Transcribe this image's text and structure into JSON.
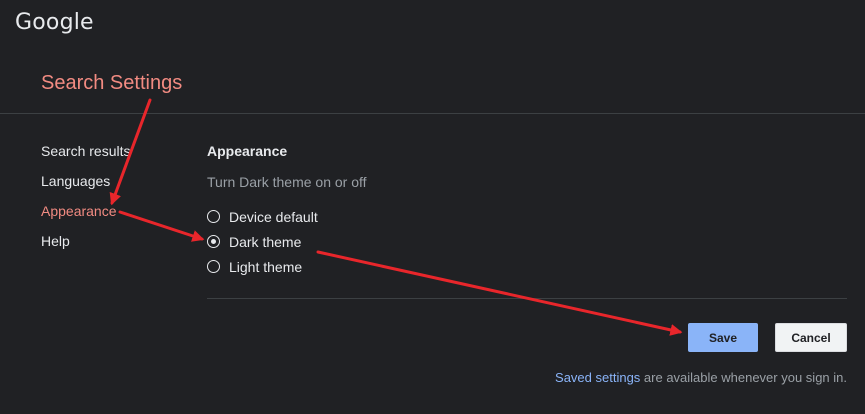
{
  "header": {
    "logo_text": "Google",
    "page_title": "Search Settings"
  },
  "sidebar": {
    "items": [
      {
        "label": "Search results",
        "active": false
      },
      {
        "label": "Languages",
        "active": false
      },
      {
        "label": "Appearance",
        "active": true
      },
      {
        "label": "Help",
        "active": false
      }
    ]
  },
  "appearance": {
    "heading": "Appearance",
    "description": "Turn Dark theme on or off",
    "options": [
      {
        "label": "Device default",
        "checked": false
      },
      {
        "label": "Dark theme",
        "checked": true
      },
      {
        "label": "Light theme",
        "checked": false
      }
    ]
  },
  "actions": {
    "save_label": "Save",
    "cancel_label": "Cancel"
  },
  "footer": {
    "link_text": "Saved settings",
    "note_text": " are available whenever you sign in."
  },
  "colors": {
    "background": "#202124",
    "accent": "#f28b82",
    "primary_button": "#8ab4f8",
    "annotation_arrow": "#e8262b"
  },
  "icons": {
    "arrow": "annotation-arrow",
    "radio": "radio-button"
  }
}
